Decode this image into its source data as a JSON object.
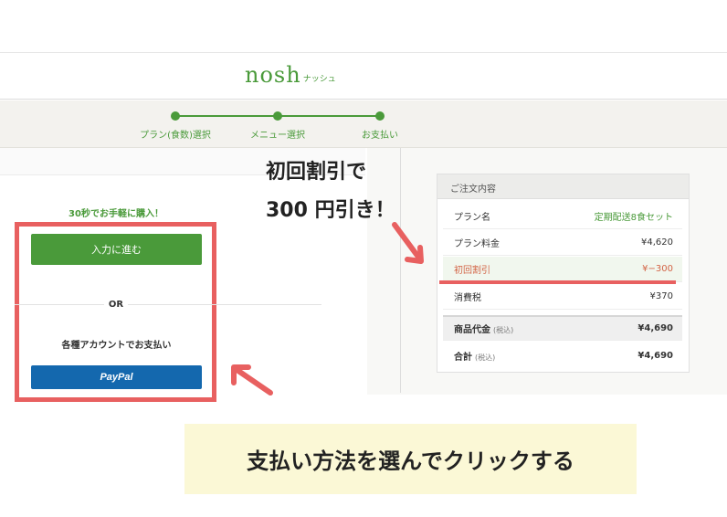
{
  "header": {
    "logo_main": "nosh",
    "logo_kana": "ナッシュ"
  },
  "steps": [
    {
      "label": "プラン(食数)選択"
    },
    {
      "label": "メニュー選択"
    },
    {
      "label": "お支払い"
    }
  ],
  "payment": {
    "promo": "30秒でお手軽に購入！",
    "proceed_label": "入力に進む",
    "or_label": "OR",
    "account_label": "各種アカウントでお支払い",
    "paypal_label": "PayPal"
  },
  "order": {
    "title": "ご注文内容",
    "rows": [
      {
        "label": "プラン名",
        "value": "定期配送8食セット"
      },
      {
        "label": "プラン料金",
        "value": "¥4,620"
      },
      {
        "label": "初回割引",
        "value": "¥−300"
      },
      {
        "label": "消費税",
        "value": "¥370"
      }
    ],
    "subtotal": {
      "label": "商品代金",
      "note": "(税込)",
      "value": "¥4,690"
    },
    "total": {
      "label": "合計",
      "note": "(税込)",
      "value": "¥4,690"
    }
  },
  "annotations": {
    "callout_line1": "初回割引で",
    "callout_line2": "300 円引き！",
    "banner": "支払い方法を選んでクリックする"
  },
  "colors": {
    "brand_green": "#4a9a3a",
    "annotation_red": "#e86060",
    "paypal_blue": "#1468ae",
    "banner_bg": "#fbf8d6"
  }
}
